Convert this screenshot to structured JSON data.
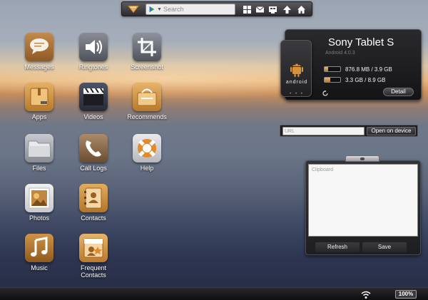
{
  "toolbar": {
    "search_placeholder": "Search",
    "icons": [
      "logo-icon",
      "grid-icon",
      "mail-icon",
      "screen-icon",
      "upload-icon",
      "home-icon"
    ]
  },
  "apps": [
    {
      "label": "Messages",
      "icon": "messages-icon"
    },
    {
      "label": "Ringtones",
      "icon": "speaker-icon"
    },
    {
      "label": "Screenshot",
      "icon": "crop-icon"
    },
    {
      "label": "Apps",
      "icon": "box-icon"
    },
    {
      "label": "Videos",
      "icon": "clapper-icon"
    },
    {
      "label": "Recommends",
      "icon": "bag-icon"
    },
    {
      "label": "Files",
      "icon": "folder-icon"
    },
    {
      "label": "Call Logs",
      "icon": "phone-icon"
    },
    {
      "label": "Help",
      "icon": "lifebuoy-icon"
    },
    {
      "label": "Photos",
      "icon": "photo-icon"
    },
    {
      "label": "Contacts",
      "icon": "contacts-icon"
    },
    {
      "label": "Music",
      "icon": "music-icon"
    },
    {
      "label": "Frequent\nContacts",
      "icon": "frequent-contacts-icon"
    }
  ],
  "device": {
    "name": "Sony Tablet S",
    "version": "Android 4.0.3",
    "android_label": "android",
    "page_dots": "• • •",
    "storage_phone": {
      "text": "876.8 MB / 3.9 GB",
      "fill": 0.22
    },
    "storage_sd": {
      "text": "3.3 GB / 8.9 GB",
      "fill": 0.37
    },
    "detail_label": "Detail"
  },
  "url": {
    "placeholder": "URL",
    "button_label": "Open on device"
  },
  "clipboard": {
    "placeholder": "Clipboard",
    "refresh_label": "Refresh",
    "save_label": "Save"
  },
  "status": {
    "battery": "100%"
  },
  "colors": {
    "accent_orange": "#e0a656",
    "panel_dark": "#1e1e21"
  }
}
